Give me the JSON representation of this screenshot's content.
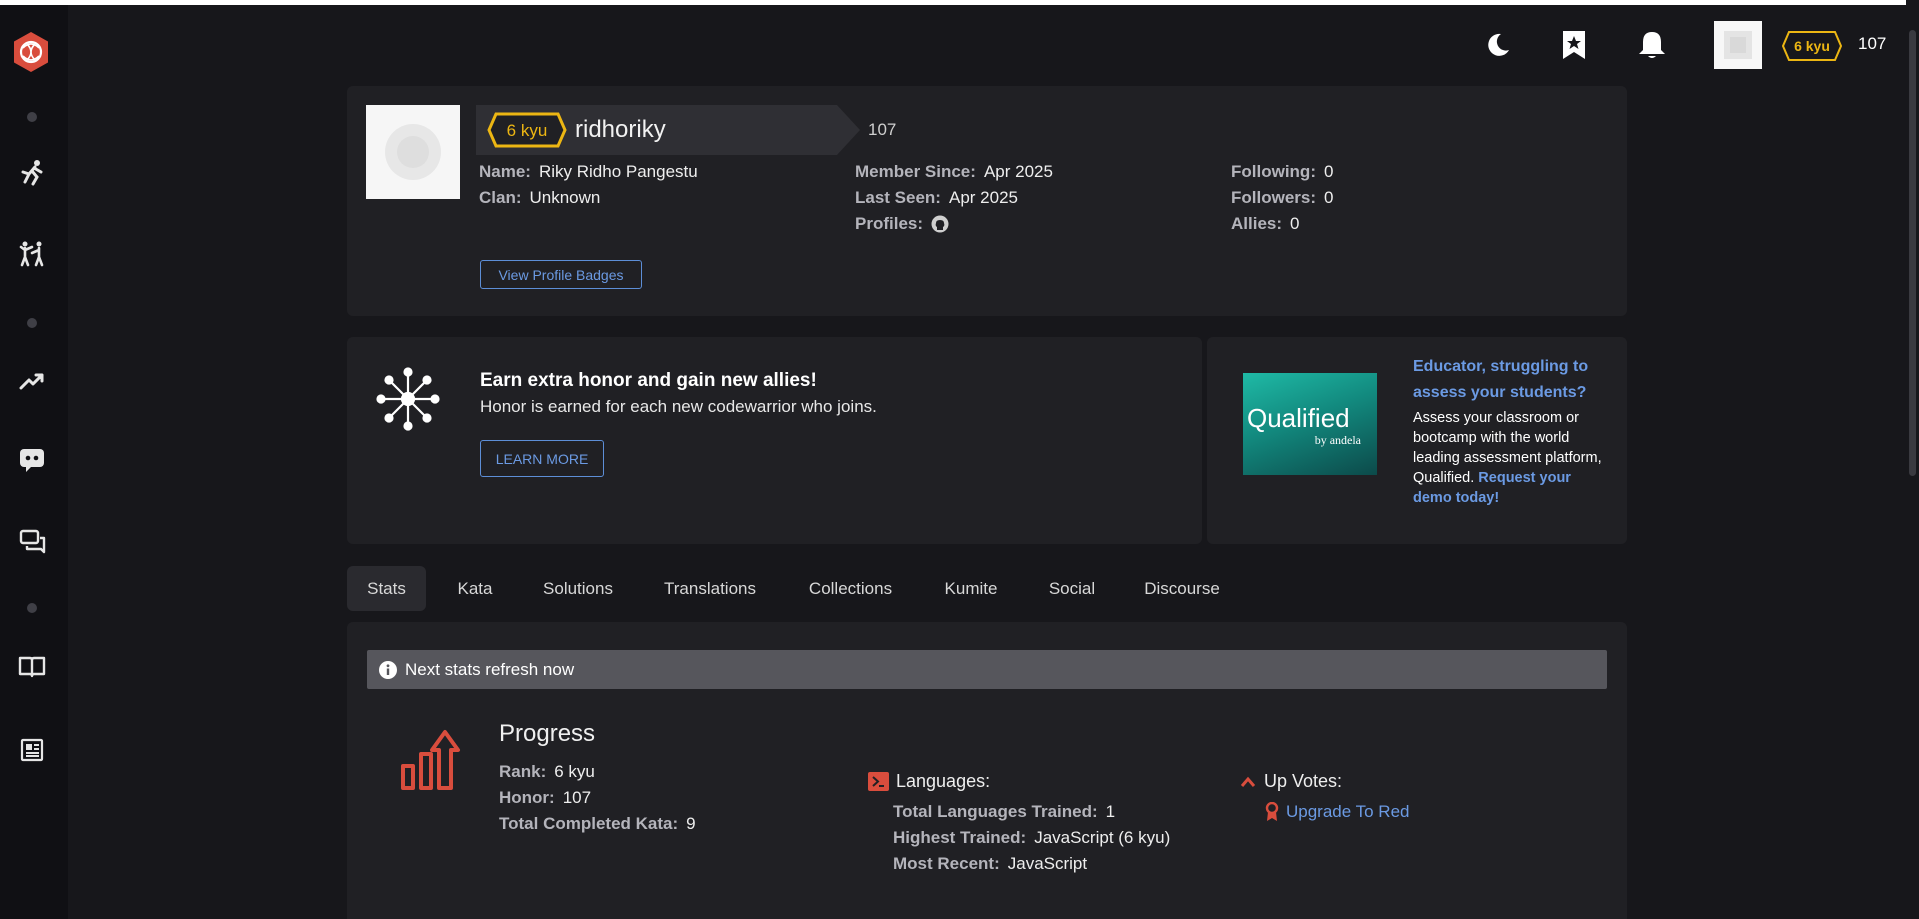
{
  "user": {
    "rank": "6 kyu",
    "username": "ridhoriky",
    "honor": "107"
  },
  "topbar": {
    "rank": "6 kyu",
    "honor": "107"
  },
  "profile": {
    "name_label": "Name:",
    "name": "Riky Ridho Pangestu",
    "clan_label": "Clan:",
    "clan": "Unknown",
    "member_since_label": "Member Since:",
    "member_since": "Apr 2025",
    "last_seen_label": "Last Seen:",
    "last_seen": "Apr 2025",
    "profiles_label": "Profiles:",
    "following_label": "Following:",
    "following": "0",
    "followers_label": "Followers:",
    "followers": "0",
    "allies_label": "Allies:",
    "allies": "0",
    "badges_button": "View Profile Badges"
  },
  "promo": {
    "title": "Earn extra honor and gain new allies!",
    "text": "Honor is earned for each new codewarrior who joins.",
    "button": "LEARN MORE"
  },
  "ad": {
    "logo_main": "Qualified",
    "logo_sub": "by andela",
    "headline": "Educator, struggling to assess your students?",
    "body": "Assess your classroom or bootcamp with the world leading assessment platform, Qualified.",
    "cta": "Request your demo today!"
  },
  "tabs": [
    "Stats",
    "Kata",
    "Solutions",
    "Translations",
    "Collections",
    "Kumite",
    "Social",
    "Discourse"
  ],
  "stats": {
    "notice": "Next stats refresh now",
    "progress_title": "Progress",
    "rank_label": "Rank:",
    "rank": "6 kyu",
    "honor_label": "Honor:",
    "honor": "107",
    "completed_label": "Total Completed Kata:",
    "completed": "9",
    "languages_title": "Languages:",
    "total_lang_label": "Total Languages Trained:",
    "total_lang": "1",
    "highest_label": "Highest Trained:",
    "highest": "JavaScript (6 kyu)",
    "recent_label": "Most Recent:",
    "recent": "JavaScript",
    "upvotes_title": "Up Votes:",
    "upgrade": "Upgrade To Red"
  },
  "colors": {
    "accent_red": "#d94d3d",
    "rank_yellow": "#ecb613",
    "link_blue": "#6b9ae3"
  },
  "icons": {
    "logo": "codewars-logo-icon",
    "theme": "moon-icon",
    "bookmarks": "bookmark-star-icon",
    "notifications": "bell-icon",
    "github": "github-icon",
    "info": "info-icon",
    "progress": "progress-chart-icon",
    "languages": "terminal-icon",
    "upvotes": "chevron-up-icon",
    "award": "award-ribbon-icon"
  }
}
